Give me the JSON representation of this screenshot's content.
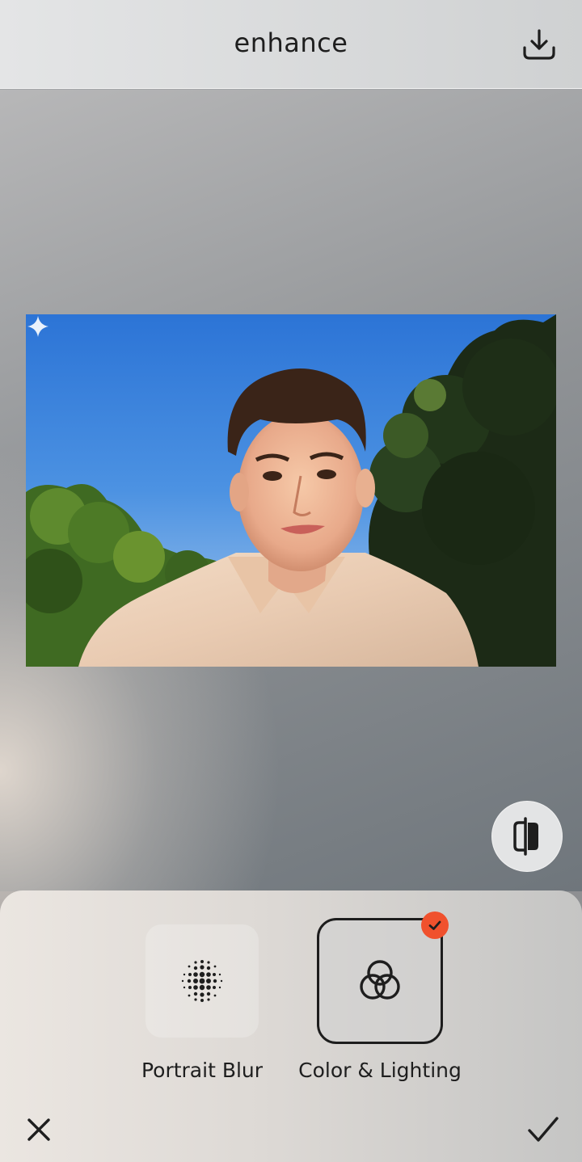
{
  "header": {
    "title": "enhance",
    "download_icon": "download-icon"
  },
  "canvas": {
    "photo_description_icon": "sparkle-icon",
    "compare_icon": "compare-icon"
  },
  "tools": [
    {
      "label": "Portrait Blur",
      "icon": "dot-grid-icon",
      "selected": false
    },
    {
      "label": "Color & Lighting",
      "icon": "overlapping-circles-icon",
      "selected": true
    }
  ],
  "footer": {
    "close_icon": "close-icon",
    "apply_icon": "checkmark-icon"
  },
  "colors": {
    "accent": "#f0512d",
    "text": "#1e1e1e"
  }
}
